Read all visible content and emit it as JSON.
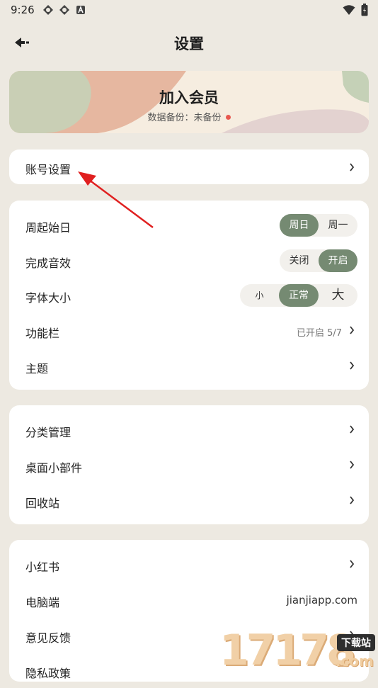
{
  "status_bar": {
    "time": "9:26"
  },
  "header": {
    "title": "设置"
  },
  "member_card": {
    "title": "加入会员",
    "subtitle": "数据备份：未备份"
  },
  "account": {
    "label": "账号设置"
  },
  "preferences": {
    "week_start": {
      "label": "周起始日",
      "options": [
        "周日",
        "周一"
      ],
      "selected": "周日"
    },
    "sound": {
      "label": "完成音效",
      "options": [
        "关闭",
        "开启"
      ],
      "selected": "开启"
    },
    "font_size": {
      "label": "字体大小",
      "options": [
        "小",
        "正常",
        "大"
      ],
      "selected": "正常"
    },
    "toolbar": {
      "label": "功能栏",
      "value": "已开启 5/7"
    },
    "theme": {
      "label": "主题"
    }
  },
  "manage": {
    "category": "分类管理",
    "widget": "桌面小部件",
    "recycle": "回收站"
  },
  "more": {
    "xiaohongshu": "小红书",
    "desktop": {
      "label": "电脑端",
      "value": "jianjiapp.com"
    },
    "feedback": "意见反馈",
    "privacy": "隐私政策"
  },
  "watermark": {
    "digits": "17178",
    "tag": "下载站",
    "suffix": ".com"
  },
  "colors": {
    "accent": "#758a72",
    "background": "#ede9e1",
    "annotation": "#e02020"
  }
}
